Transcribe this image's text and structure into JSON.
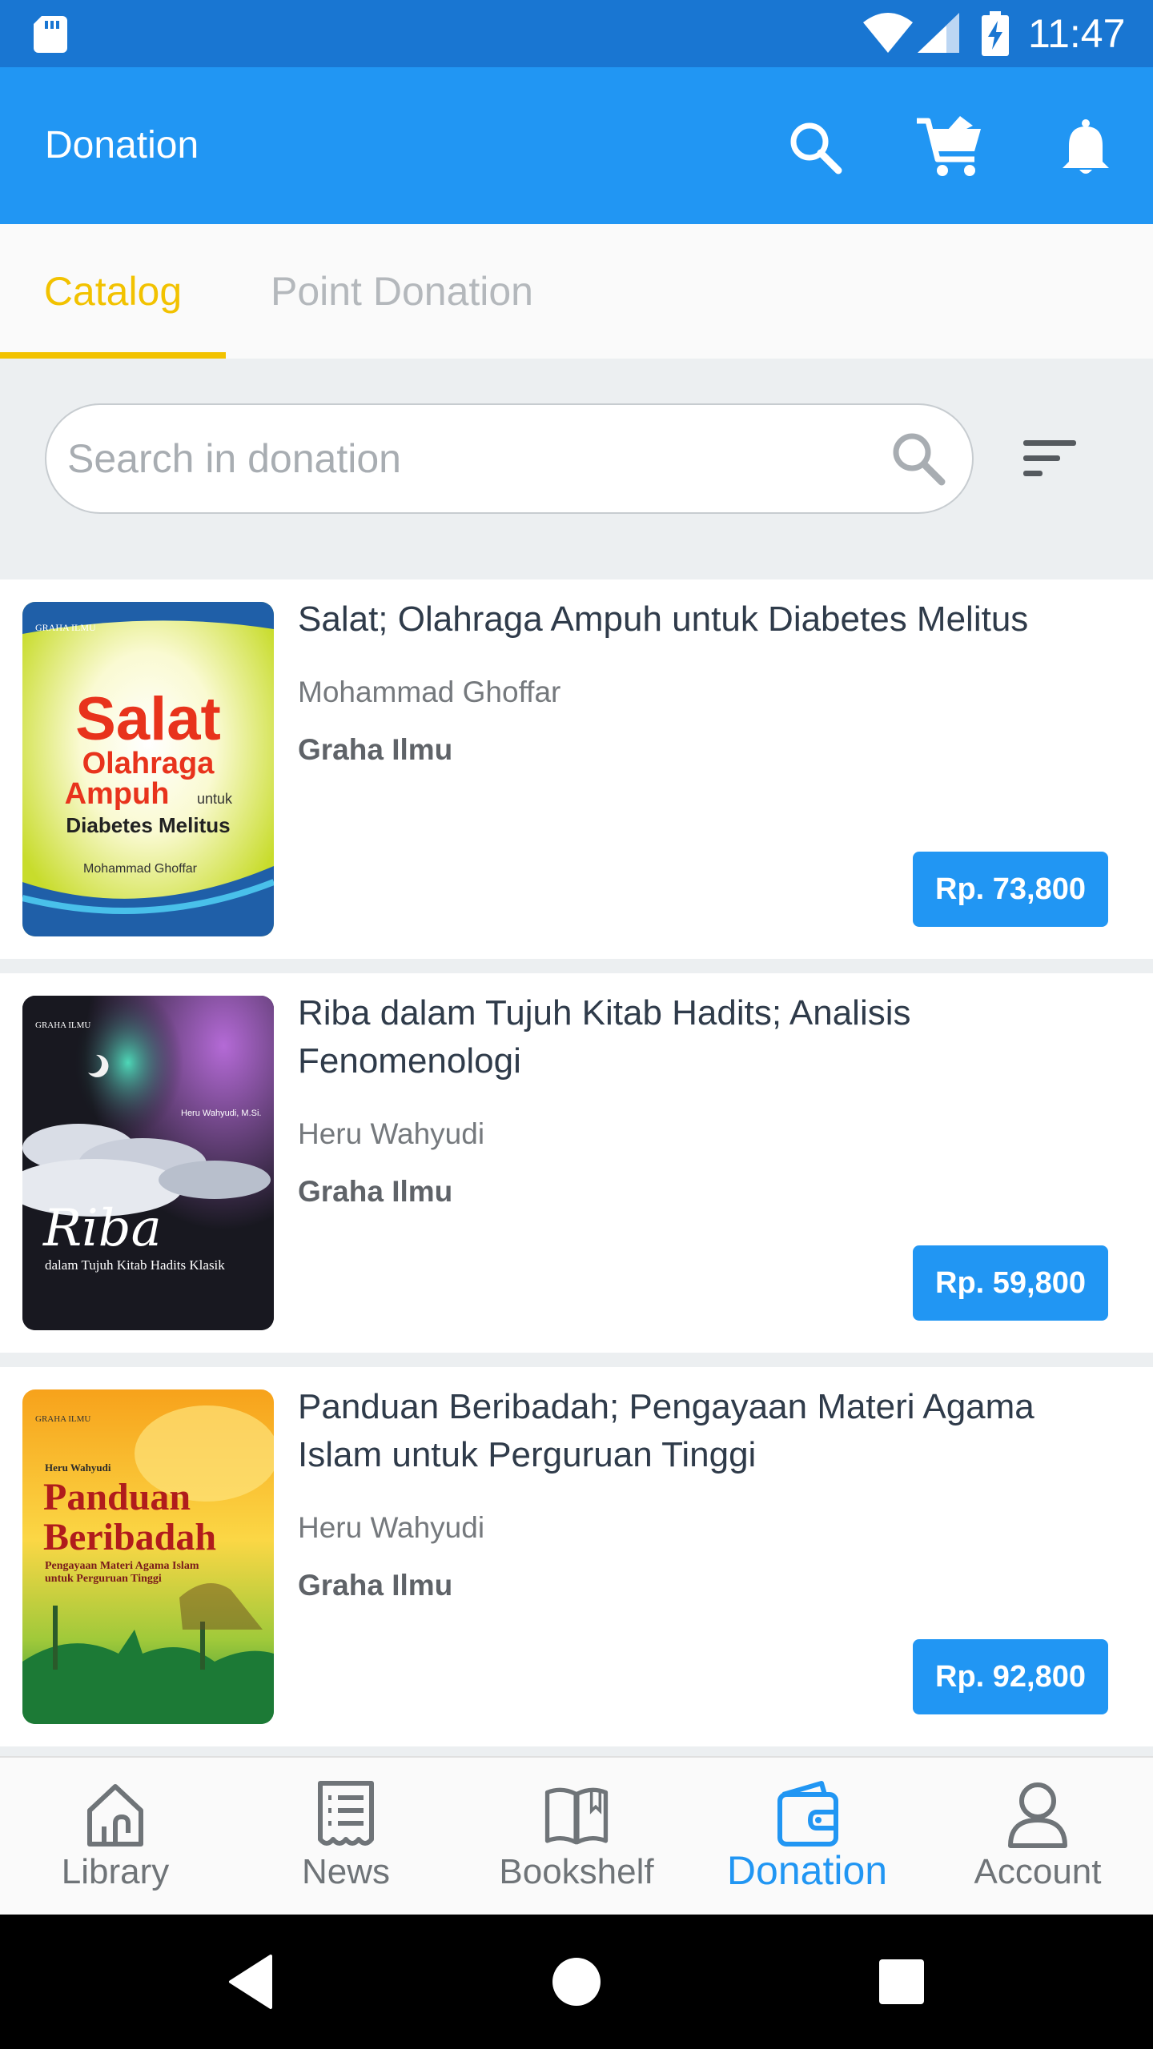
{
  "status_bar": {
    "time": "11:47"
  },
  "app_bar": {
    "title": "Donation"
  },
  "tabs": [
    {
      "label": "Catalog",
      "active": true
    },
    {
      "label": "Point Donation",
      "active": false
    }
  ],
  "search": {
    "placeholder": "Search in donation",
    "value": ""
  },
  "books": [
    {
      "title": "Salat; Olahraga Ampuh untuk Diabetes Melitus",
      "author": "Mohammad Ghoffar",
      "publisher": "Graha Ilmu",
      "price": "Rp. 73,800",
      "cover": {
        "publisher_mark": "GRAHA ILMU",
        "line1": "Salat",
        "line2": "Olahraga",
        "line3": "Ampuh",
        "line3_small": "untuk",
        "line4": "Diabetes Melitus",
        "author": "Mohammad Ghoffar"
      }
    },
    {
      "title": "Riba dalam Tujuh Kitab Hadits; Analisis Fenomenologi",
      "author": "Heru Wahyudi",
      "publisher": "Graha Ilmu",
      "price": "Rp. 59,800",
      "cover": {
        "publisher_mark": "GRAHA ILMU",
        "author": "Heru Wahyudi, M.Si.",
        "line1": "Riba",
        "line2": "dalam Tujuh Kitab Hadits Klasik"
      }
    },
    {
      "title": "Panduan Beribadah; Pengayaan Materi Agama Islam untuk Perguruan Tinggi",
      "author": "Heru Wahyudi",
      "publisher": "Graha Ilmu",
      "price": "Rp. 92,800",
      "cover": {
        "publisher_mark": "GRAHA ILMU",
        "author": "Heru Wahyudi",
        "line1": "Panduan",
        "line2": "Beribadah",
        "line3": "Pengayaan Materi Agama Islam",
        "line4": "untuk Perguruan Tinggi"
      }
    }
  ],
  "bottom_nav": [
    {
      "label": "Library",
      "icon": "home-icon",
      "active": false
    },
    {
      "label": "News",
      "icon": "news-icon",
      "active": false
    },
    {
      "label": "Bookshelf",
      "icon": "book-open-icon",
      "active": false
    },
    {
      "label": "Donation",
      "icon": "wallet-icon",
      "active": true
    },
    {
      "label": "Account",
      "icon": "person-icon",
      "active": false
    }
  ],
  "colors": {
    "status_bar": "#1976d2",
    "primary": "#2196f3",
    "accent": "#f2c200",
    "nav_inactive": "#6f7478"
  }
}
